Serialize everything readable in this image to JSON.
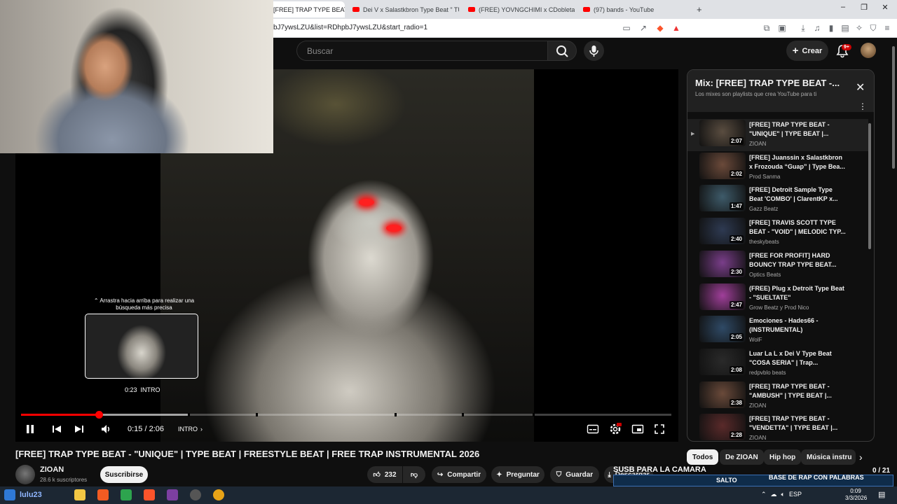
{
  "browser": {
    "tabs": [
      {
        "label": "[FREE] TRAP TYPE BEAT -",
        "active": true
      },
      {
        "label": "Dei V x Salastkbron Type Beat \" TU S"
      },
      {
        "label": "(FREE) YOVNGCHIMI x CDobleta Typ"
      },
      {
        "label": "(97) bands - YouTube"
      }
    ],
    "new_tab": "+",
    "url": "bJ7ywsLZU&list=RDhpbJ7ywsLZU&start_radio=1",
    "window_controls": [
      "–",
      "❐",
      "✕"
    ]
  },
  "header": {
    "search_placeholder": "Buscar",
    "create_label": "Crear",
    "notif_badge": "9+"
  },
  "player": {
    "hint": "⌃ Arrastra hacia arriba para realizar una búsqueda más precisa",
    "preview_time": "0:23",
    "preview_chapter": "INTRO",
    "timecode": "0:15 / 2:06",
    "chapter": "INTRO",
    "progress_fraction": 0.12,
    "buffer_fraction": 0.256
  },
  "video": {
    "title": "[FREE] TRAP TYPE BEAT - \"UNIQUE\" | TYPE BEAT | FREESTYLE BEAT | FREE TRAP INSTRUMENTAL 2026",
    "channel": "ZIOAN",
    "subscribers": "28.6 k suscriptores",
    "subscribe_label": "Suscribirse",
    "likes": "232",
    "share_label": "Compartir",
    "ask_label": "Preguntar",
    "save_label": "Guardar",
    "download_label": "Descargar"
  },
  "playlist": {
    "title": "Mix: [FREE] TRAP TYPE BEAT -...",
    "subtitle": "Los mixes son playlists que crea YouTube para ti",
    "items": [
      {
        "title": "[FREE] TRAP TYPE BEAT - \"UNIQUE\" | TYPE BEAT |...",
        "channel": "ZIOAN",
        "duration": "2:07"
      },
      {
        "title": "[FREE] Juanssin x Salastkbron x Frozouda “Guap” | Type Bea...",
        "channel": "Prod Sanma",
        "duration": "2:02"
      },
      {
        "title": "[FREE] Detroit Sample Type Beat 'COMBO' | ClarentKP x...",
        "channel": "Gazz Beatz",
        "duration": "1:47"
      },
      {
        "title": "[FREE] TRAVIS SCOTT TYPE BEAT - \"VOID\" | MELODIC TYP...",
        "channel": "theskybeats",
        "duration": "2:40"
      },
      {
        "title": "[FREE FOR PROFIT] HARD BOUNCY TRAP TYPE BEAT...",
        "channel": "Optics Beats",
        "duration": "2:30"
      },
      {
        "title": "(FREE) Plug x Detroit Type Beat - \"SUELTATE\"",
        "channel": "Grow Beatz y Prod Nico",
        "duration": "2:47"
      },
      {
        "title": "Emociones - Hades66 - (INSTRUMENTAL)",
        "channel": "WolF",
        "duration": "2:05"
      },
      {
        "title": "Luar La L x Dei V Type Beat \"COSA SERIA\" | Trap...",
        "channel": "redpvblo beats",
        "duration": "2:08"
      },
      {
        "title": "[FREE] TRAP TYPE BEAT - \"AMBUSH\" | TYPE BEAT |...",
        "channel": "ZIOAN",
        "duration": "2:38"
      },
      {
        "title": "[FREE] TRAP TYPE BEAT - \"VENDETTA\" | TYPE BEAT |...",
        "channel": "ZIOAN",
        "duration": "2:28"
      }
    ]
  },
  "chips": [
    "Todos",
    "De ZIOAN",
    "Hip hop",
    "Música instru"
  ],
  "overlay": {
    "caption": "SUSB PARA LA CAMARA",
    "salto": "SALTO",
    "rap_text": "BASE DE RAP CON PALABRAS",
    "count": "0 / 21"
  },
  "taskbar": {
    "user_tag": "lulu23",
    "clock_time": "0:09",
    "clock_date": "3/3/2026",
    "lang": "ESP"
  },
  "colors": {
    "accent": "#ff0000",
    "bg": "#0f0f0f"
  }
}
